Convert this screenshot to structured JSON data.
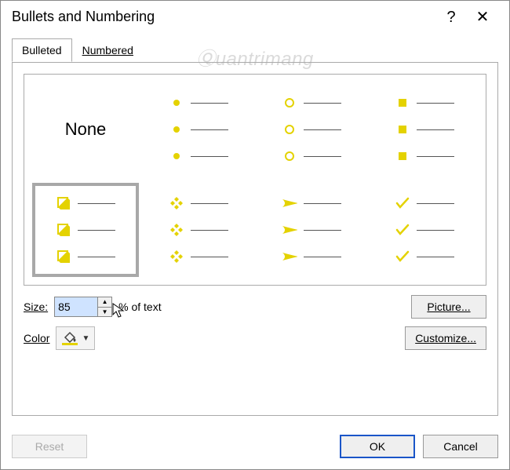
{
  "title": "Bullets and Numbering",
  "tabs": {
    "bulleted": "Bulleted",
    "numbered": "Numbered"
  },
  "none_label": "None",
  "bullet_styles": [
    "none",
    "disc",
    "ring",
    "square",
    "box3d",
    "diamond4",
    "arrowhead",
    "check"
  ],
  "selected_style_index": 4,
  "size": {
    "label": "Size:",
    "value": "85",
    "suffix": "% of text"
  },
  "color": {
    "label": "Color"
  },
  "buttons": {
    "picture": "Picture...",
    "customize": "Customize...",
    "reset": "Reset",
    "ok": "OK",
    "cancel": "Cancel"
  },
  "watermark": "Ⓠuantrimang"
}
